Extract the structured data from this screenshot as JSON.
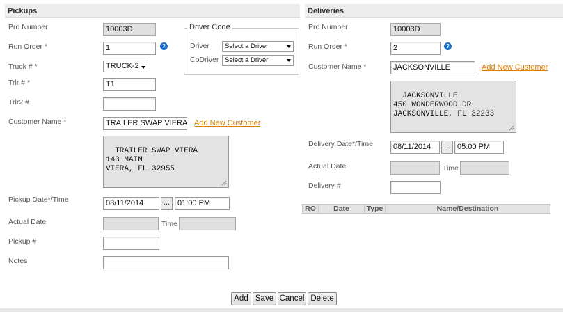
{
  "pickups": {
    "title": "Pickups",
    "pro_number": {
      "label": "Pro Number",
      "value": "10003D"
    },
    "run_order": {
      "label": "Run Order *",
      "value": "1",
      "help_glyph": "?"
    },
    "truck": {
      "label": "Truck # *",
      "value": "TRUCK-2"
    },
    "trlr": {
      "label": "Trlr # *",
      "value": "T1"
    },
    "trlr2": {
      "label": "Trlr2 #",
      "value": ""
    },
    "customer_name": {
      "label": "Customer Name *",
      "value": "TRAILER SWAP VIERA",
      "add_link": "Add New Customer"
    },
    "address": "TRAILER SWAP VIERA\n143 MAIN\nVIERA, FL 32955",
    "pickup_datetime": {
      "label": "Pickup Date*/Time",
      "date": "08/11/2014",
      "picker": "...",
      "time": "01:00 PM"
    },
    "actual_date": {
      "label": "Actual Date",
      "date": "",
      "time_label": "Time",
      "time": ""
    },
    "pickup_no": {
      "label": "Pickup #",
      "value": ""
    },
    "notes": {
      "label": "Notes",
      "value": ""
    }
  },
  "driver_code": {
    "legend": "Driver Code",
    "driver": {
      "label": "Driver",
      "value": "Select a Driver"
    },
    "codriver": {
      "label": "CoDriver",
      "value": "Select a Driver"
    }
  },
  "deliveries": {
    "title": "Deliveries",
    "pro_number": {
      "label": "Pro Number",
      "value": "10003D"
    },
    "run_order": {
      "label": "Run Order *",
      "value": "2",
      "help_glyph": "?"
    },
    "customer_name": {
      "label": "Customer Name *",
      "value": "JACKSONVILLE",
      "add_link": "Add New Customer"
    },
    "address": "JACKSONVILLE\n450 WONDERWOOD DR\nJACKSONVILLE, FL 32233",
    "delivery_datetime": {
      "label": "Delivery Date*/Time",
      "date": "08/11/2014",
      "picker": "...",
      "time": "05:00 PM"
    },
    "actual_date": {
      "label": "Actual Date",
      "date": "",
      "time_label": "Time",
      "time": ""
    },
    "delivery_no": {
      "label": "Delivery #",
      "value": ""
    },
    "grid_columns": [
      "RO",
      "Date",
      "Type",
      "Name/Destination"
    ]
  },
  "buttons": {
    "add": "Add",
    "save": "Save",
    "cancel": "Cancel",
    "delete": "Delete"
  }
}
